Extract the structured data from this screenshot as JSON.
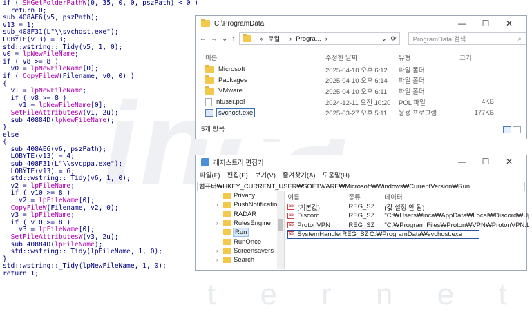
{
  "code_lines": [
    [
      {
        "t": "if ( "
      },
      {
        "t": "SHGetFolderPathW",
        "c": "fn"
      },
      {
        "t": "(0, 35, 0, 0, pszPath) < 0 )"
      }
    ],
    [
      {
        "t": "  return 0;"
      }
    ],
    [
      {
        "t": "sub_408AE6(v5, pszPath);"
      }
    ],
    [
      {
        "t": "v13 = 1;"
      }
    ],
    [
      {
        "t": "sub_408F31(L\"\\\\svchost.exe\");"
      }
    ],
    [
      {
        "t": "LOBYTE(v13) = 3;"
      }
    ],
    [
      {
        "t": "std::wstring::_Tidy(v5, 1, 0);"
      }
    ],
    [
      {
        "t": "v0 = "
      },
      {
        "t": "lpNewFileName",
        "c": "fn"
      },
      {
        "t": ";"
      }
    ],
    [
      {
        "t": "if ( v8 >= 8 )"
      }
    ],
    [
      {
        "t": "  v0 = "
      },
      {
        "t": "lpNewFileName",
        "c": "fn"
      },
      {
        "t": "[0];"
      }
    ],
    [
      {
        "t": "if ( "
      },
      {
        "t": "CopyFileW",
        "c": "fn"
      },
      {
        "t": "(Filename, v0, 0) )"
      }
    ],
    [
      {
        "t": "{"
      }
    ],
    [
      {
        "t": "  v1 = "
      },
      {
        "t": "lpNewFileName",
        "c": "fn"
      },
      {
        "t": ";"
      }
    ],
    [
      {
        "t": "  if ( v8 >= 8 )"
      }
    ],
    [
      {
        "t": "    v1 = "
      },
      {
        "t": "lpNewFileName",
        "c": "fn"
      },
      {
        "t": "[0];"
      }
    ],
    [
      {
        "t": "  "
      },
      {
        "t": "SetFileAttributesW",
        "c": "fn"
      },
      {
        "t": "(v1, 2u);"
      }
    ],
    [
      {
        "t": "  sub_40884D("
      },
      {
        "t": "lpNewFileName",
        "c": "fn"
      },
      {
        "t": ");"
      }
    ],
    [
      {
        "t": "}"
      }
    ],
    [
      {
        "t": "else"
      }
    ],
    [
      {
        "t": "{"
      }
    ],
    [
      {
        "t": "  sub_408AE6(v6, pszPath);"
      }
    ],
    [
      {
        "t": "  LOBYTE(v13) = 4;"
      }
    ],
    [
      {
        "t": "  sub_408F31(L\"\\\\svcppa.exe\");"
      }
    ],
    [
      {
        "t": "  LOBYTE(v13) = 6;"
      }
    ],
    [
      {
        "t": "  std::wstring::_Tidy(v6, 1, 0);"
      }
    ],
    [
      {
        "t": "  v2 = "
      },
      {
        "t": "lpFileName",
        "c": "fn"
      },
      {
        "t": ";"
      }
    ],
    [
      {
        "t": "  if ( v10 >= 8 )"
      }
    ],
    [
      {
        "t": "    v2 = "
      },
      {
        "t": "lpFileName",
        "c": "fn"
      },
      {
        "t": "[0];"
      }
    ],
    [
      {
        "t": "  "
      },
      {
        "t": "CopyFileW",
        "c": "fn"
      },
      {
        "t": "(Filename, v2, 0);"
      }
    ],
    [
      {
        "t": "  v3 = "
      },
      {
        "t": "lpFileName",
        "c": "fn"
      },
      {
        "t": ";"
      }
    ],
    [
      {
        "t": "  if ( v10 >= 8 )"
      }
    ],
    [
      {
        "t": "    v3 = "
      },
      {
        "t": "lpFileName",
        "c": "fn"
      },
      {
        "t": "[0];"
      }
    ],
    [
      {
        "t": "  "
      },
      {
        "t": "SetFileAttributesW",
        "c": "fn"
      },
      {
        "t": "(v3, 2u);"
      }
    ],
    [
      {
        "t": "  sub_40884D("
      },
      {
        "t": "lpFileName",
        "c": "fn"
      },
      {
        "t": ");"
      }
    ],
    [
      {
        "t": "  std::wstring::_Tidy(lpFileName, 1, 0);"
      }
    ],
    [
      {
        "t": "}"
      }
    ],
    [
      {
        "t": "std::wstring::_Tidy(lpNewFileName, 1, 0);"
      }
    ],
    [
      {
        "t": "return 1;"
      }
    ]
  ],
  "explorer": {
    "title": "C:\\ProgramData",
    "controls": {
      "minimize": "—",
      "maximize": "☐",
      "close": "✕"
    },
    "nav": {
      "back": "←",
      "forward": "→",
      "down": "⌄",
      "up": "↑",
      "refresh": "⟳"
    },
    "address": {
      "prefix": "«",
      "part1": "로컬...",
      "sep": "›",
      "part2": "Progra...",
      "chevron": "›",
      "dropdown": "⌄"
    },
    "search_placeholder": "ProgramData 검색",
    "search_icon": "⌕",
    "columns": {
      "name": "이름",
      "date": "수정한 날짜",
      "type": "유형",
      "size": "크기"
    },
    "rows": [
      {
        "name": "Microsoft",
        "date": "2025-04-10 오후 6:12",
        "type": "파일 폴더",
        "size": "",
        "icon": "folder"
      },
      {
        "name": "Packages",
        "date": "2025-04-10 오후 6:14",
        "type": "파일 폴더",
        "size": "",
        "icon": "folder"
      },
      {
        "name": "VMware",
        "date": "2025-04-10 오후 6:11",
        "type": "파일 폴더",
        "size": "",
        "icon": "folder"
      },
      {
        "name": "ntuser.pol",
        "date": "2024-12-11 오전 10:20",
        "type": "POL 파일",
        "size": "4KB",
        "icon": "file"
      },
      {
        "name": "svchost.exe",
        "date": "2025-03-27 오후 5:11",
        "type": "응용 프로그램",
        "size": "177KB",
        "icon": "exe",
        "selected": true
      }
    ],
    "status": "5개 항목"
  },
  "registry": {
    "title": "레지스트리 편집기",
    "controls": {
      "minimize": "—",
      "maximize": "☐",
      "close": "✕"
    },
    "menu": [
      "파일(F)",
      "편집(E)",
      "보기(V)",
      "즐겨찾기(A)",
      "도움말(H)"
    ],
    "address": "컴퓨터₩HKEY_CURRENT_USER₩SOFTWARE₩Microsoft₩Windows₩CurrentVersion₩Run",
    "tree": [
      {
        "label": "Privacy",
        "arrow": ""
      },
      {
        "label": "PushNotifications",
        "arrow": "›"
      },
      {
        "label": "RADAR",
        "arrow": ""
      },
      {
        "label": "RulesEngine",
        "arrow": "›"
      },
      {
        "label": "Run",
        "arrow": "",
        "selected": true
      },
      {
        "label": "RunOnce",
        "arrow": ""
      },
      {
        "label": "Screensavers",
        "arrow": "›"
      },
      {
        "label": "Search",
        "arrow": "›"
      }
    ],
    "columns": {
      "name": "이름",
      "type": "종류",
      "data": "데이터"
    },
    "values": [
      {
        "name": "(기본값)",
        "type": "REG_SZ",
        "data": "(값 설정 안 됨)"
      },
      {
        "name": "Discord",
        "type": "REG_SZ",
        "data": "\"C:₩Users₩inca₩AppData₩Local₩Discord₩Upda..."
      },
      {
        "name": "ProtonVPN",
        "type": "REG_SZ",
        "data": "\"C:₩Program Files₩Proton₩VPN₩ProtonVPN.Lau..."
      },
      {
        "name": "SystemHandler",
        "type": "REG_SZ",
        "data": "C:₩ProgramData₩svchost.exe",
        "highlighted": true
      }
    ],
    "ab_icon_text": "ab"
  },
  "watermark": {
    "big": "inca",
    "small": "i n c a   i n t e r n e t"
  }
}
